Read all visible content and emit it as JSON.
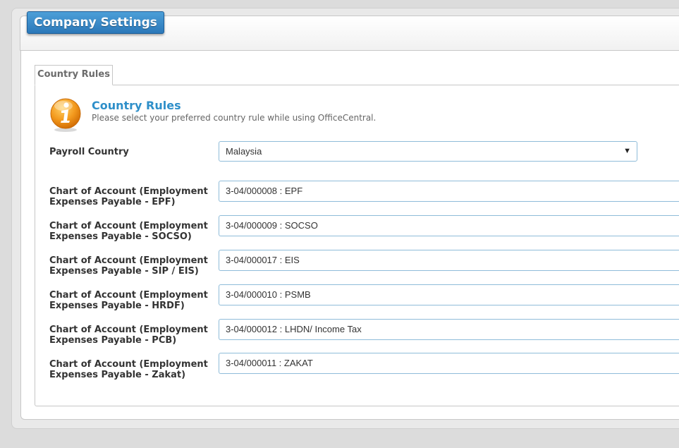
{
  "header": {
    "title": "Company Settings"
  },
  "tabs": [
    {
      "label": "Country Rules",
      "active": true
    }
  ],
  "section": {
    "icon": "info-icon",
    "title": "Country Rules",
    "description": "Please select your preferred country rule while using OfficeCentral."
  },
  "payroll_country": {
    "label": "Payroll Country",
    "selected": "Malaysia"
  },
  "accounts": [
    {
      "label": "Chart of Account (Employment Expenses Payable - EPF)",
      "value": "3-04/000008 : EPF"
    },
    {
      "label": "Chart of Account (Employment Expenses Payable - SOCSO)",
      "value": "3-04/000009 : SOCSO"
    },
    {
      "label": "Chart of Account (Employment Expenses Payable - SIP / EIS)",
      "value": "3-04/000017 : EIS"
    },
    {
      "label": "Chart of Account (Employment Expenses Payable - HRDF)",
      "value": "3-04/000010 : PSMB"
    },
    {
      "label": "Chart of Account (Employment Expenses Payable - PCB)",
      "value": "3-04/000012 : LHDN/ Income Tax"
    },
    {
      "label": "Chart of Account (Employment Expenses Payable - Zakat)",
      "value": "3-04/000011 : ZAKAT"
    }
  ],
  "colors": {
    "accent": "#2e8fc9",
    "title_button": "#2b78b9",
    "field_border": "#8fbcd9",
    "icon_orange": "#f39a1e"
  }
}
